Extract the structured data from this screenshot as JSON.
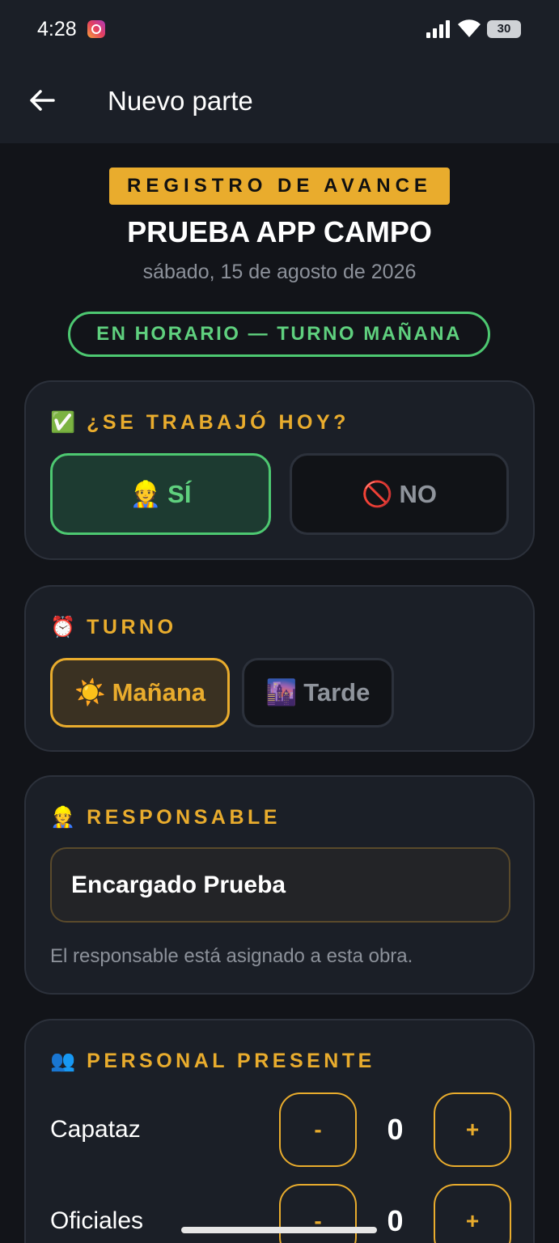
{
  "status_bar": {
    "time": "4:28",
    "battery": "30"
  },
  "app_bar": {
    "title": "Nuevo parte"
  },
  "header": {
    "tag": "REGISTRO DE AVANCE",
    "project": "PRUEBA APP CAMPO",
    "date": "sábado, 15 de agosto de 2026",
    "status": "EN HORARIO — TURNO MAÑANA"
  },
  "worked_today": {
    "emoji": "✅",
    "title": "¿SE TRABAJÓ HOY?",
    "yes": {
      "emoji": "👷",
      "label": "SÍ"
    },
    "no": {
      "emoji": "🚫",
      "label": "NO"
    },
    "selected": "yes"
  },
  "shift": {
    "emoji": "⏰",
    "title": "TURNO",
    "morning": {
      "emoji": "☀️",
      "label": "Mañana"
    },
    "afternoon": {
      "emoji": "🌆",
      "label": "Tarde"
    },
    "selected": "morning"
  },
  "responsible": {
    "emoji": "👷",
    "title": "RESPONSABLE",
    "value": "Encargado Prueba",
    "note": "El responsable está asignado a esta obra."
  },
  "staff": {
    "emoji": "👥",
    "title": "PERSONAL PRESENTE",
    "minus_label": "-",
    "plus_label": "+",
    "rows": [
      {
        "label": "Capataz",
        "value": "0"
      },
      {
        "label": "Oficiales",
        "value": "0"
      }
    ]
  },
  "colors": {
    "accent": "#e9ac2d",
    "success": "#4dc871",
    "background": "#121419",
    "card": "#1b1f27"
  }
}
